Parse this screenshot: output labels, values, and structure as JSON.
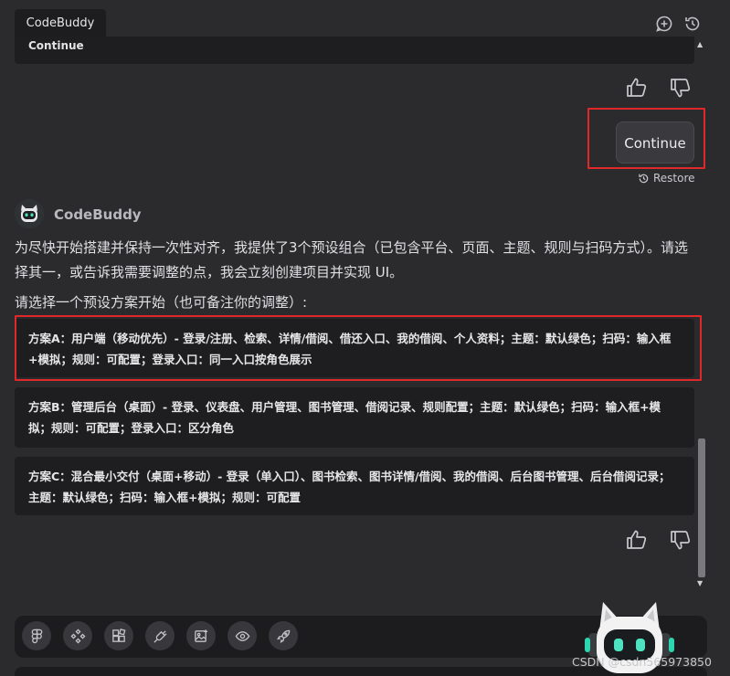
{
  "header": {
    "title": "CodeBuddy",
    "icons": [
      "add-chat-icon",
      "history-icon"
    ]
  },
  "top_card": {
    "text": "Continue"
  },
  "user_message": {
    "text": "Continue",
    "restore_label": "Restore"
  },
  "assistant": {
    "name": "CodeBuddy",
    "paragraph": "为尽快开始搭建并保持一次性对齐，我提供了3个预设组合（已包含平台、页面、主题、规则与扫码方式）。请选择其一，或告诉我需要调整的点，我会立刻创建项目并实现 UI。",
    "prompt": "请选择一个预设方案开始（也可备注你的调整）:",
    "options": [
      {
        "text": "方案A：用户端（移动优先）- 登录/注册、检索、详情/借阅、借还入口、我的借阅、个人资料；主题：默认绿色；扫码：输入框+模拟；规则：可配置；登录入口：同一入口按角色展示"
      },
      {
        "text": "方案B：管理后台（桌面）- 登录、仪表盘、用户管理、图书管理、借阅记录、规则配置；主题：默认绿色；扫码：输入框+模拟；规则：可配置；登录入口：区分角色"
      },
      {
        "text": "方案C：混合最小交付（桌面+移动）- 登录（单入口）、图书检索、图书详情/借阅、我的借阅、后台图书管理、后台借阅记录；主题：默认绿色；扫码：输入框+模拟；规则：可配置"
      }
    ]
  },
  "toolbar": {
    "tools": [
      "figma-icon",
      "components-icon",
      "blocks-icon",
      "plugin-icon",
      "image-icon",
      "preview-eye-icon",
      "rocket-icon"
    ]
  },
  "watermark": "CSDN @csdn565973850",
  "colors": {
    "background": "#2b2b2e",
    "card": "#1e1e21",
    "highlight": "#e0282a"
  }
}
